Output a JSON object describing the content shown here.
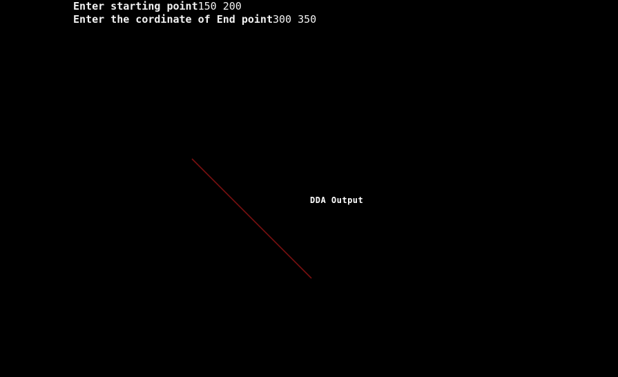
{
  "console": {
    "line1": {
      "prompt": "Enter starting point",
      "input": "150 200"
    },
    "line2": {
      "prompt": "Enter the cordinate of End point",
      "input": "300 350"
    }
  },
  "graphics": {
    "label": "DDA Output",
    "line_color": "#7a1010",
    "background_color": "#000000",
    "text_color": "#ffffff"
  }
}
